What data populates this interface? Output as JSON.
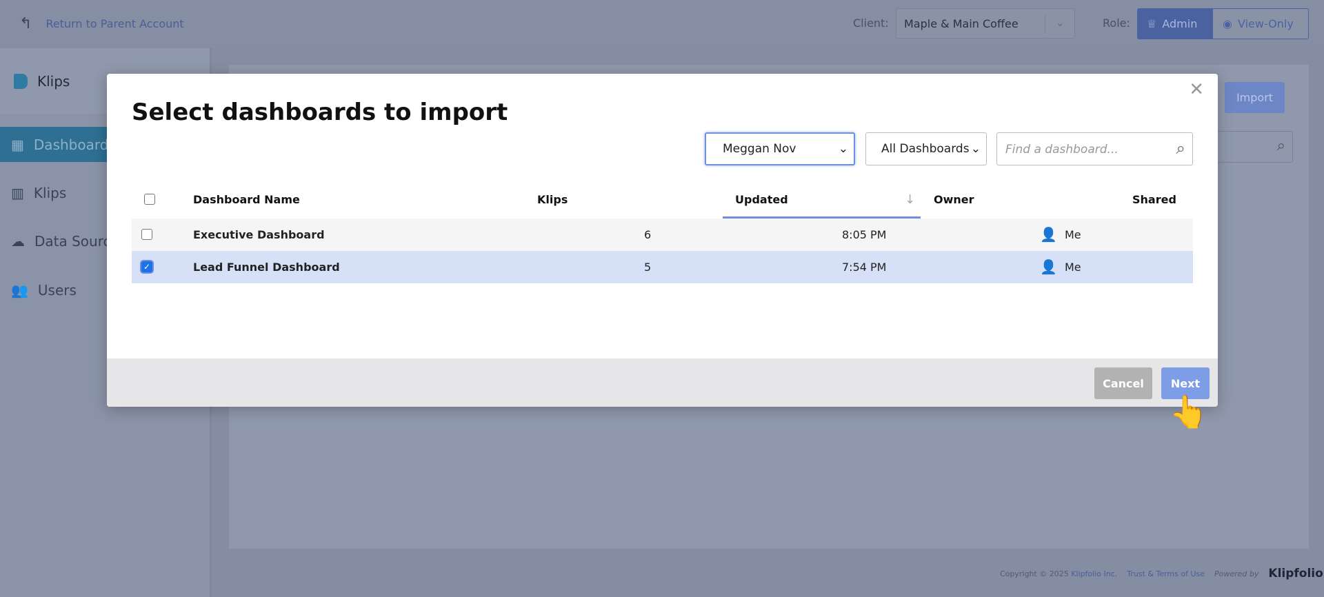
{
  "topbar": {
    "return_label": "Return to Parent Account",
    "client_label": "Client:",
    "client_value": "Maple & Main Coffee",
    "role_label": "Role:",
    "role_admin": "Admin",
    "role_viewonly": "View-Only"
  },
  "sidebar": {
    "brand": "Klips",
    "items": [
      {
        "label": "Dashboards",
        "icon": "dashboard-icon",
        "active": true
      },
      {
        "label": "Klips",
        "icon": "bar-chart-icon"
      },
      {
        "label": "Data Sources",
        "icon": "cloud-icon"
      },
      {
        "label": "Users",
        "icon": "users-icon"
      }
    ]
  },
  "main": {
    "import_label": "Import"
  },
  "footer": {
    "copyright": "Copyright © 2025",
    "company": "Klipfolio Inc.",
    "terms": "Trust & Terms of Use",
    "powered": "Powered by",
    "brand": "Klipfolio"
  },
  "modal": {
    "title": "Select dashboards to import",
    "owner_select": "Meggan Nov",
    "filter_select": "All Dashboards",
    "search_placeholder": "Find a dashboard...",
    "columns": {
      "name": "Dashboard Name",
      "klips": "Klips",
      "updated": "Updated",
      "owner": "Owner",
      "shared": "Shared"
    },
    "sort": {
      "column": "Updated",
      "direction": "descending"
    },
    "rows": [
      {
        "name": "Executive Dashboard",
        "klips": "6",
        "updated": "8:05 PM",
        "owner": "Me",
        "checked": false
      },
      {
        "name": "Lead Funnel Dashboard",
        "klips": "5",
        "updated": "7:54 PM",
        "owner": "Me",
        "checked": true
      }
    ],
    "cancel_label": "Cancel",
    "next_label": "Next"
  },
  "colors": {
    "accent": "#6f8ee0",
    "selected_row": "#d6e0f7",
    "active_nav": "#2e6f93"
  }
}
